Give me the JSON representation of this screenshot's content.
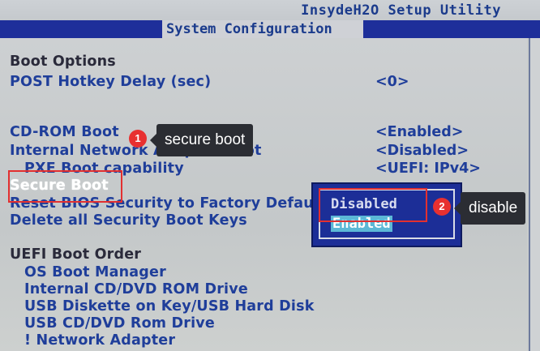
{
  "header": {
    "utility_title": "InsydeH2O Setup Utility",
    "active_tab": "System Configuration"
  },
  "boot_options": {
    "heading": "Boot Options",
    "post_hotkey_delay": {
      "label": "POST Hotkey Delay (sec)",
      "value": "<0>"
    },
    "cdrom_boot": {
      "label": "CD-ROM Boot",
      "value": "<Enabled>"
    },
    "internal_network_adapter_boot": {
      "label": "Internal Network Adapter Boot",
      "value": "<Disabled>"
    },
    "pxe_boot_capability": {
      "label": "PXE Boot capability",
      "value": "<UEFI: IPv4>"
    },
    "secure_boot": {
      "label": "Secure Boot"
    },
    "reset_bios_security": {
      "label": "Reset BIOS Security to Factory Default"
    },
    "delete_secure_boot_keys": {
      "label": "Delete all Security Boot Keys"
    }
  },
  "uefi_boot_order": {
    "heading": "UEFI Boot Order",
    "items": [
      "OS Boot Manager",
      "Internal CD/DVD ROM Drive",
      "USB Diskette on Key/USB Hard Disk",
      "USB CD/DVD Rom Drive",
      "! Network Adapter"
    ]
  },
  "popup": {
    "options": [
      "Disabled",
      "Enabled"
    ],
    "selected": "Disabled"
  },
  "annotations": {
    "step1": {
      "number": "1",
      "text": "secure boot"
    },
    "step2": {
      "number": "2",
      "text": "disable"
    }
  },
  "colors": {
    "bios_text": "#1f3e9a",
    "tab_bar": "#1e2f9a",
    "annotation_red": "#e23030",
    "tooltip_bg": "#2b2d33"
  }
}
